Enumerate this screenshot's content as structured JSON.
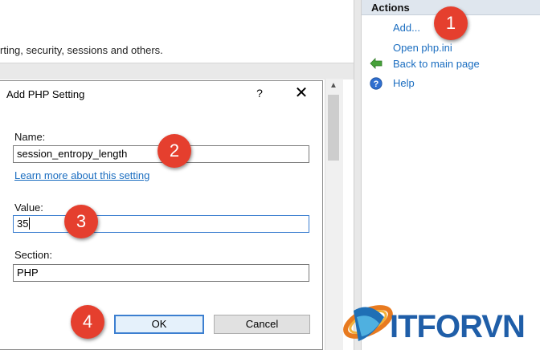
{
  "main": {
    "description": "rting, security, sessions and others."
  },
  "actions": {
    "header": "Actions",
    "items": [
      {
        "label": "Add...",
        "icon": "none"
      },
      {
        "label": "Open php.ini",
        "icon": "none"
      },
      {
        "label": "Back to main page",
        "icon": "green-back-arrow-icon"
      },
      {
        "label": "Help",
        "icon": "help-icon"
      }
    ]
  },
  "dialog": {
    "title": "Add PHP Setting",
    "help_glyph": "?",
    "close_glyph": "✕",
    "name_label": "Name:",
    "name_value": "session_entropy_length",
    "learn_more": "Learn more about this setting",
    "value_label": "Value:",
    "value_value": "35",
    "section_label": "Section:",
    "section_value": "PHP",
    "ok_label": "OK",
    "cancel_label": "Cancel"
  },
  "badges": [
    "1",
    "2",
    "3",
    "4"
  ],
  "logo": {
    "text": "ITFORVN"
  },
  "colors": {
    "link": "#1a6dc0",
    "badge": "#e53f2e",
    "focus_border": "#3c7fd0",
    "actions_header_bg": "#dfe6ee"
  }
}
